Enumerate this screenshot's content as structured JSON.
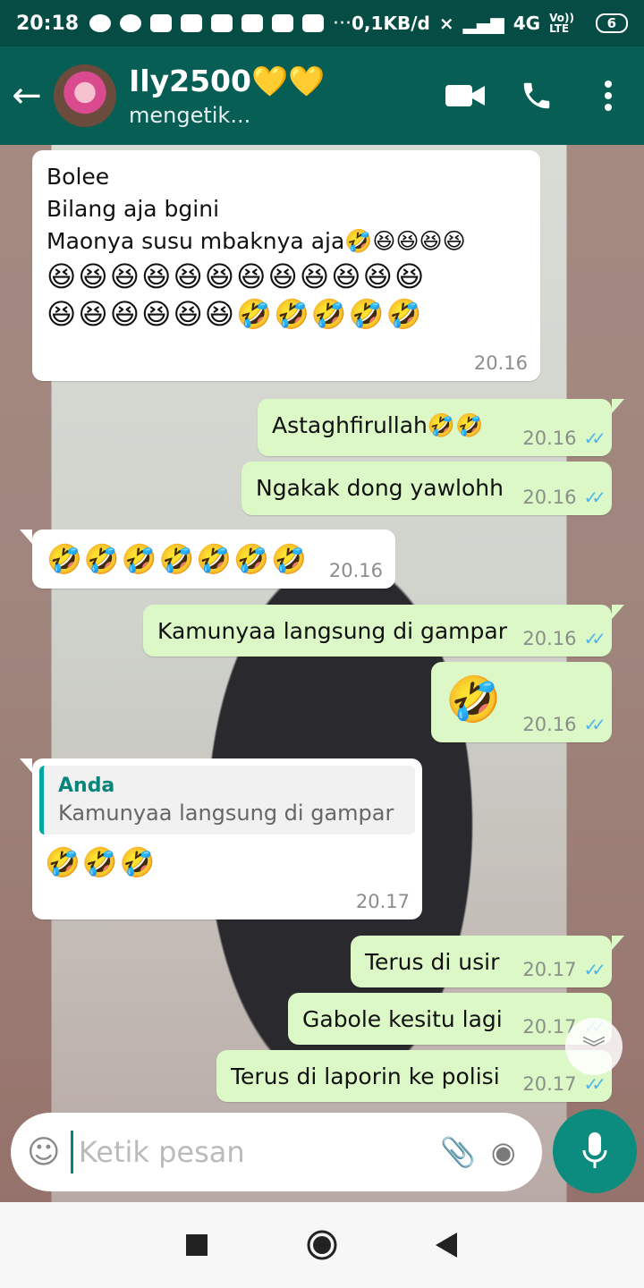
{
  "status_bar": {
    "time": "20:18",
    "network_speed": "0,1KB/d",
    "signal": "4G",
    "volte": "Vo)) LTE",
    "battery": "6"
  },
  "header": {
    "contact_name": "Ily2500💛💛",
    "contact_status": "mengetik...",
    "back_icon": "←",
    "video_icon": "video-call-icon",
    "call_icon": "phone-icon",
    "menu_icon": "more-vertical-icon"
  },
  "messages": [
    {
      "dir": "in",
      "lines": [
        "Bolee",
        "Bilang aja bgini",
        "Maonya susu mbaknya aja🤣😆😆😆😆"
      ],
      "emoji_lines": [
        "😆😆😆😆😆😆😆😆😆😆😆😆",
        "😆😆😆😆😆😆🤣🤣🤣🤣🤣"
      ],
      "time": "20.16"
    },
    {
      "dir": "out",
      "text": "Astaghfirullah🤣🤣",
      "time": "20.16"
    },
    {
      "dir": "out",
      "text": "Ngakak dong yawlohh",
      "time": "20.16"
    },
    {
      "dir": "in",
      "text": "🤣🤣🤣🤣🤣🤣🤣",
      "time": "20.16"
    },
    {
      "dir": "out",
      "text": "Kamunyaa langsung di gampar",
      "time": "20.16"
    },
    {
      "dir": "out",
      "text": "🤣",
      "time": "20.16"
    },
    {
      "dir": "in",
      "quote_name": "Anda",
      "quote_text": "Kamunyaa langsung di gampar",
      "text": "🤣🤣🤣",
      "time": "20.17"
    },
    {
      "dir": "out",
      "text": "Terus di usir",
      "time": "20.17"
    },
    {
      "dir": "out",
      "text": "Gabole kesitu lagi",
      "time": "20.17"
    },
    {
      "dir": "out",
      "text": "Terus di laporin ke polisi",
      "time": "20.17"
    }
  ],
  "composer": {
    "placeholder": "Ketik pesan"
  },
  "colors": {
    "header": "#075e54",
    "outgoing": "#dcf8c6",
    "incoming": "#ffffff",
    "ticks": "#4fb6ec",
    "mic": "#0b8c7f"
  }
}
